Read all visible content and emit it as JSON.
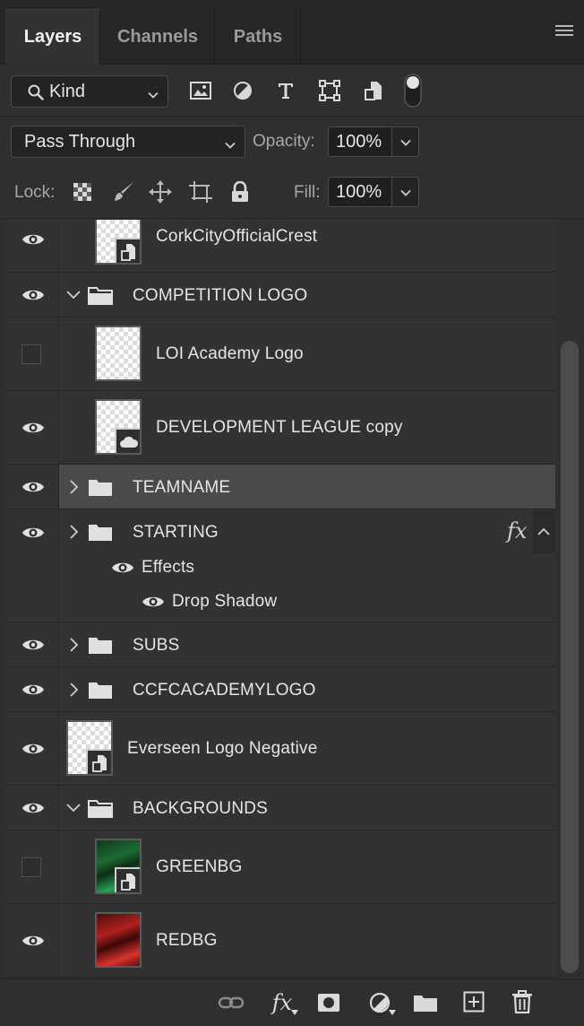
{
  "tabs": [
    {
      "label": "Layers",
      "active": true
    },
    {
      "label": "Channels",
      "active": false
    },
    {
      "label": "Paths",
      "active": false
    }
  ],
  "filter": {
    "kind_label": "Kind",
    "icons": [
      "image-filter-icon",
      "adjustment-filter-icon",
      "type-filter-icon",
      "shape-filter-icon",
      "smart-object-filter-icon",
      "filter-toggle-switch"
    ]
  },
  "blend": {
    "mode": "Pass Through",
    "opacity_label": "Opacity:",
    "opacity_value": "100%"
  },
  "lock": {
    "label": "Lock:",
    "icons": [
      "lock-transparent-pixels-icon",
      "lock-image-pixels-icon",
      "lock-position-icon",
      "lock-artboard-icon",
      "lock-all-icon"
    ],
    "fill_label": "Fill:",
    "fill_value": "100%"
  },
  "layers": [
    {
      "name": "CorkCityOfficialCrest",
      "visible": true,
      "kind": "smart-object"
    },
    {
      "name": "COMPETITION LOGO",
      "visible": true,
      "kind": "group",
      "expanded": true
    },
    {
      "name": "LOI Academy Logo",
      "visible": false,
      "kind": "pixel"
    },
    {
      "name": "DEVELOPMENT LEAGUE  copy",
      "visible": true,
      "kind": "linked-smart-object"
    },
    {
      "name": "TEAMNAME",
      "visible": true,
      "kind": "group",
      "expanded": false,
      "selected": true
    },
    {
      "name": "STARTING",
      "visible": true,
      "kind": "group",
      "expanded": false,
      "has_effects": true,
      "effects_label": "Effects",
      "effects": [
        "Drop Shadow"
      ],
      "fx_symbol": "fx"
    },
    {
      "name": "SUBS",
      "visible": true,
      "kind": "group",
      "expanded": false
    },
    {
      "name": "CCFCACADEMYLOGO",
      "visible": true,
      "kind": "group",
      "expanded": false
    },
    {
      "name": "Everseen Logo Negative",
      "visible": true,
      "kind": "smart-object"
    },
    {
      "name": "BACKGROUNDS",
      "visible": true,
      "kind": "group",
      "expanded": true
    },
    {
      "name": "GREENBG",
      "visible": false,
      "kind": "smart-object"
    },
    {
      "name": "REDBG",
      "visible": true,
      "kind": "smart-object"
    }
  ],
  "bottom_bar": {
    "fx_label": "fx",
    "icons": [
      "link-layers-icon",
      "add-layer-style-icon",
      "add-mask-icon",
      "new-adjustment-layer-icon",
      "new-group-icon",
      "new-layer-icon",
      "delete-layer-icon"
    ]
  },
  "colors": {
    "panel_bg": "#323232",
    "selected_row": "#4a4a4a",
    "text": "#e6e6e6"
  }
}
